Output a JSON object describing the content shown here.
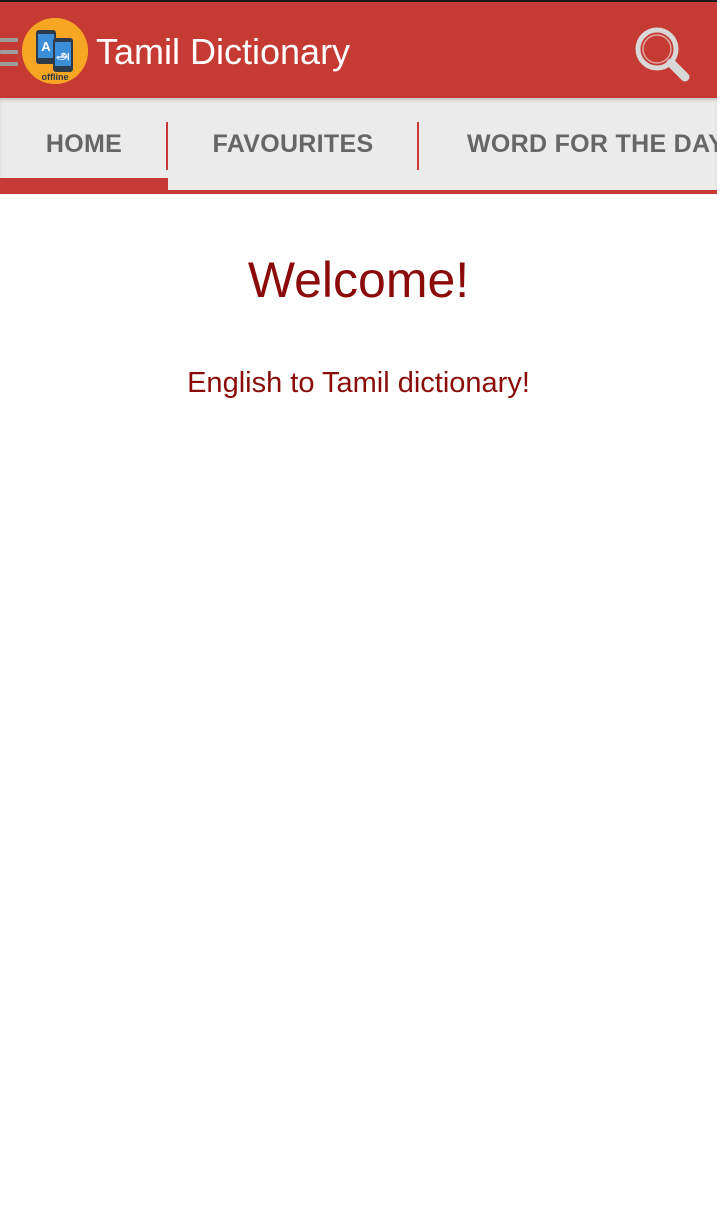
{
  "app_bar": {
    "title": "Tamil Dictionary",
    "logo_caption": "offline",
    "logo_letter_latin": "A",
    "logo_letter_tamil": "அ",
    "background_color": "#c53a32",
    "icons": {
      "drawer": "hamburger-menu-icon",
      "logo": "app-logo-icon",
      "search": "search-icon"
    }
  },
  "tabs": [
    {
      "label": "HOME",
      "selected": true
    },
    {
      "label": "FAVOURITES",
      "selected": false
    },
    {
      "label": "WORD FOR THE DAY",
      "selected": false
    }
  ],
  "main": {
    "title": "Welcome!",
    "subtitle": "English to Tamil dictionary!",
    "text_color": "#8b0b0b"
  }
}
